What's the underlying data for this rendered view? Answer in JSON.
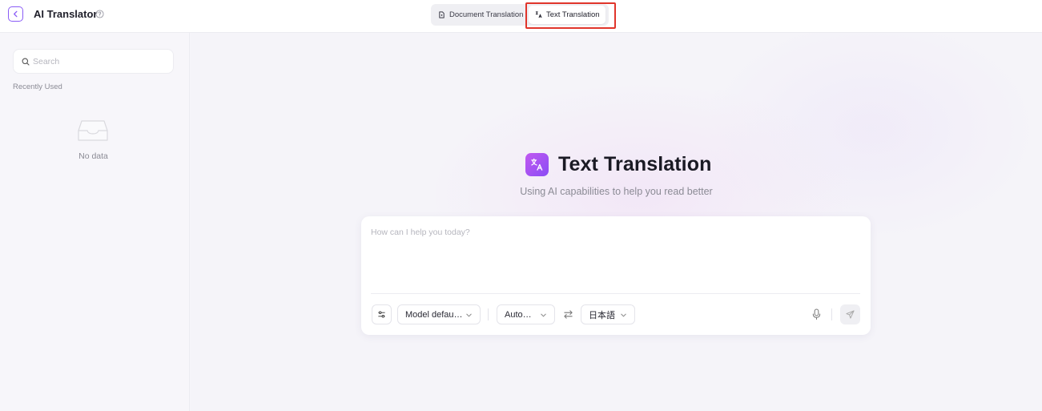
{
  "header": {
    "app_title": "AI Translator",
    "tabs": [
      {
        "label": "Document Translation",
        "icon": "document-icon"
      },
      {
        "label": "Text Translation",
        "icon": "translate-icon",
        "active": true
      }
    ]
  },
  "sidebar": {
    "search_placeholder": "Search",
    "section_label": "Recently Used",
    "empty_text": "No data"
  },
  "main": {
    "title": "Text Translation",
    "subtitle": "Using AI capabilities to help you read better",
    "input_placeholder": "How can I help you today?",
    "model_select": "Model defau…",
    "source_language": "Auto…",
    "target_language": "日本語"
  },
  "colors": {
    "accent": "#8a5cf6",
    "highlight_border": "#e0352b",
    "background": "#f5f4f9"
  }
}
